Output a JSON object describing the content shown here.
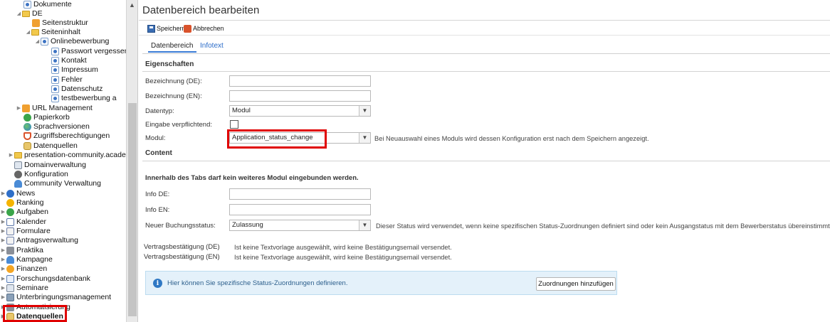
{
  "tree": {
    "items": [
      {
        "label": "Dokumente",
        "icon": "page-icon"
      },
      {
        "label": "DE",
        "icon": "folder-icon"
      },
      {
        "label": "Seitenstruktur",
        "icon": "sitemap-icon"
      },
      {
        "label": "Seiteninhalt",
        "icon": "folder-icon"
      },
      {
        "label": "Onlinebewerbung",
        "icon": "page-icon"
      },
      {
        "label": "Passwort vergessen",
        "icon": "page-icon"
      },
      {
        "label": "Kontakt",
        "icon": "page-icon"
      },
      {
        "label": "Impressum",
        "icon": "page-icon"
      },
      {
        "label": "Fehler",
        "icon": "page-icon"
      },
      {
        "label": "Datenschutz",
        "icon": "page-icon"
      },
      {
        "label": "testbewerbung a",
        "icon": "page-icon"
      },
      {
        "label": "URL Management",
        "icon": "tag-icon"
      },
      {
        "label": "Papierkorb",
        "icon": "recycle-icon"
      },
      {
        "label": "Sprachversionen",
        "icon": "globe-icon"
      },
      {
        "label": "Zugriffsberechtigungen",
        "icon": "shield-icon"
      },
      {
        "label": "Datenquellen",
        "icon": "database-icon"
      },
      {
        "label": "presentation-community.academyf",
        "icon": "folder-icon"
      },
      {
        "label": "Domainverwaltung",
        "icon": "sliders-icon"
      },
      {
        "label": "Konfiguration",
        "icon": "gear-icon"
      },
      {
        "label": "Community Verwaltung",
        "icon": "people-icon"
      },
      {
        "label": "News",
        "icon": "info-icon"
      },
      {
        "label": "Ranking",
        "icon": "trophy-icon"
      },
      {
        "label": "Aufgaben",
        "icon": "tasks-icon"
      },
      {
        "label": "Kalender",
        "icon": "calendar-icon"
      },
      {
        "label": "Formulare",
        "icon": "form-icon"
      },
      {
        "label": "Antragsverwaltung",
        "icon": "checklist-icon"
      },
      {
        "label": "Praktika",
        "icon": "briefcase-icon"
      },
      {
        "label": "Kampagne",
        "icon": "people-icon"
      },
      {
        "label": "Finanzen",
        "icon": "coins-icon"
      },
      {
        "label": "Forschungsdatenbank",
        "icon": "chart-icon"
      },
      {
        "label": "Seminare",
        "icon": "presentation-icon"
      },
      {
        "label": "Unterbringungsmanagement",
        "icon": "building-icon"
      },
      {
        "label": "Automatisierung",
        "icon": "robot-icon"
      },
      {
        "label": "Datenquellen",
        "icon": "database-icon"
      }
    ]
  },
  "page": {
    "title": "Datenbereich bearbeiten"
  },
  "toolbar": {
    "save_label": "Speichern",
    "cancel_label": "Abbrechen"
  },
  "tabs": [
    {
      "label": "Datenbereich"
    },
    {
      "label": "Infotext"
    }
  ],
  "form": {
    "section_properties": "Eigenschaften",
    "label_name_de": "Bezeichnung (DE):",
    "label_name_en": "Bezeichnung (EN):",
    "label_datatype": "Datentyp:",
    "datatype_value": "Modul",
    "label_required": "Eingabe verpflichtend:",
    "label_module": "Modul:",
    "module_value": "Application_status_change",
    "module_hint": "Bei Neuauswahl eines Moduls wird dessen Konfiguration erst nach dem Speichern angezeigt.",
    "section_content": "Content",
    "content_note": "Innerhalb des Tabs darf kein weiteres Modul eingebunden werden.",
    "label_info_de": "Info DE:",
    "label_info_en": "Info EN:",
    "label_new_status": "Neuer Buchungsstatus:",
    "new_status_value": "Zulassung",
    "new_status_hint": "Dieser Status wird verwendet, wenn keine spezifischen Status-Zuordnungen definiert sind oder kein Ausgangstatus mit dem Bewerberstatus übereinstimmt.",
    "label_contract_de": "Vertragsbestätigung (DE)",
    "contract_de_value": "Ist keine Textvorlage ausgewählt, wird keine Bestätigungsemail versendet.",
    "label_contract_en": "Vertragsbestätigung (EN)",
    "contract_en_value": "Ist keine Textvorlage ausgewählt, wird keine Bestätigungsemail versendet."
  },
  "info_box": {
    "text": "Hier können Sie spezifische Status-Zuordnungen definieren.",
    "button_label": "Zuordnungen hinzufügen"
  },
  "colors": {
    "accent": "#3a7bd5",
    "highlight": "#e00000",
    "info_bg": "#e4f1fa"
  }
}
